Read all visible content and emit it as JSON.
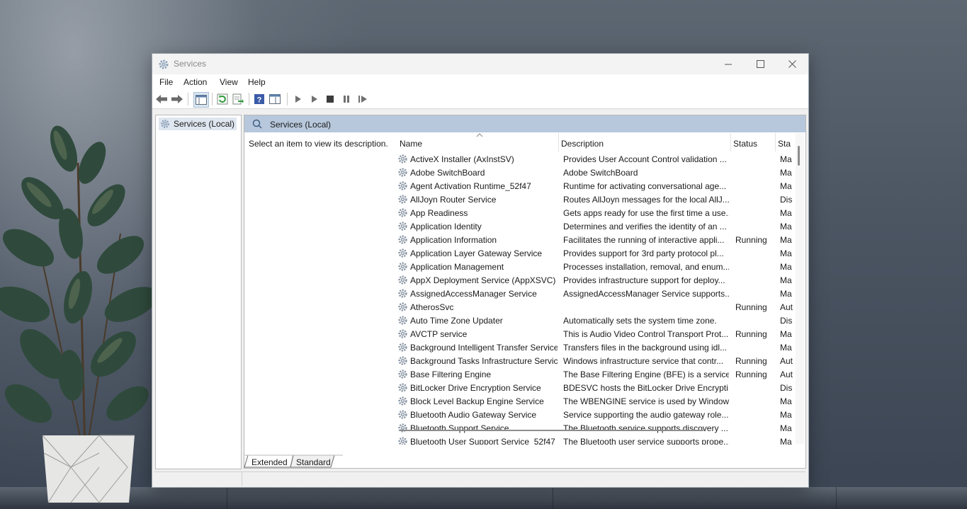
{
  "window": {
    "title": "Services",
    "controls": {
      "minimize_icon": "minimize-icon",
      "maximize_icon": "maximize-icon",
      "close_icon": "close-icon"
    }
  },
  "menu": [
    "File",
    "Action",
    "View",
    "Help"
  ],
  "toolbar": {
    "icons": [
      "back-arrow-icon",
      "forward-arrow-icon",
      "show-hide-console-tree-icon",
      "refresh-icon",
      "export-list-icon",
      "help-icon",
      "properties-icon",
      "start-service-icon",
      "start-service-alt-icon",
      "stop-service-icon",
      "pause-service-icon",
      "restart-service-icon"
    ]
  },
  "tree": {
    "root_label": "Services (Local)"
  },
  "pane": {
    "header": "Services (Local)",
    "description_prompt": "Select an item to view its description."
  },
  "columns": [
    "Name",
    "Description",
    "Status",
    "Sta"
  ],
  "services": [
    {
      "name": "ActiveX Installer (AxInstSV)",
      "description": "Provides User Account Control validation ...",
      "status": "",
      "startup": "Ma"
    },
    {
      "name": "Adobe SwitchBoard",
      "description": "Adobe SwitchBoard",
      "status": "",
      "startup": "Ma"
    },
    {
      "name": "Agent Activation Runtime_52f47",
      "description": "Runtime for activating conversational age...",
      "status": "",
      "startup": "Ma"
    },
    {
      "name": "AllJoyn Router Service",
      "description": "Routes AllJoyn messages for the local AllJ...",
      "status": "",
      "startup": "Dis"
    },
    {
      "name": "App Readiness",
      "description": "Gets apps ready for use the first time a use...",
      "status": "",
      "startup": "Ma"
    },
    {
      "name": "Application Identity",
      "description": "Determines and verifies the identity of an ...",
      "status": "",
      "startup": "Ma"
    },
    {
      "name": "Application Information",
      "description": "Facilitates the running of interactive appli...",
      "status": "Running",
      "startup": "Ma"
    },
    {
      "name": "Application Layer Gateway Service",
      "description": "Provides support for 3rd party protocol pl...",
      "status": "",
      "startup": "Ma"
    },
    {
      "name": "Application Management",
      "description": "Processes installation, removal, and enum...",
      "status": "",
      "startup": "Ma"
    },
    {
      "name": "AppX Deployment Service (AppXSVC)",
      "description": "Provides infrastructure support for deploy...",
      "status": "",
      "startup": "Ma"
    },
    {
      "name": "AssignedAccessManager Service",
      "description": "AssignedAccessManager Service supports...",
      "status": "",
      "startup": "Ma"
    },
    {
      "name": "AtherosSvc",
      "description": "",
      "status": "Running",
      "startup": "Aut"
    },
    {
      "name": "Auto Time Zone Updater",
      "description": "Automatically sets the system time zone.",
      "status": "",
      "startup": "Dis"
    },
    {
      "name": "AVCTP service",
      "description": "This is Audio Video Control Transport Prot...",
      "status": "Running",
      "startup": "Ma"
    },
    {
      "name": "Background Intelligent Transfer Service",
      "description": "Transfers files in the background using idl...",
      "status": "",
      "startup": "Ma"
    },
    {
      "name": "Background Tasks Infrastructure Service",
      "description": "Windows infrastructure service that contr...",
      "status": "Running",
      "startup": "Aut"
    },
    {
      "name": "Base Filtering Engine",
      "description": "The Base Filtering Engine (BFE) is a service...",
      "status": "Running",
      "startup": "Aut"
    },
    {
      "name": "BitLocker Drive Encryption Service",
      "description": "BDESVC hosts the BitLocker Drive Encrypti...",
      "status": "",
      "startup": "Dis"
    },
    {
      "name": "Block Level Backup Engine Service",
      "description": "The WBENGINE service is used by Window...",
      "status": "",
      "startup": "Ma"
    },
    {
      "name": "Bluetooth Audio Gateway Service",
      "description": "Service supporting the audio gateway role...",
      "status": "",
      "startup": "Ma"
    },
    {
      "name": "Bluetooth Support Service",
      "description": "The Bluetooth service supports discovery ...",
      "status": "",
      "startup": "Ma"
    },
    {
      "name": "Bluetooth User Support Service_52f47",
      "description": "The Bluetooth user service supports prope...",
      "status": "",
      "startup": "Ma"
    }
  ],
  "tabs": [
    "Extended",
    "Standard"
  ],
  "colors": {
    "pane_header": "#b7c8dc",
    "selection": "#dfe6ef",
    "window_bg": "#f0f0f0"
  }
}
